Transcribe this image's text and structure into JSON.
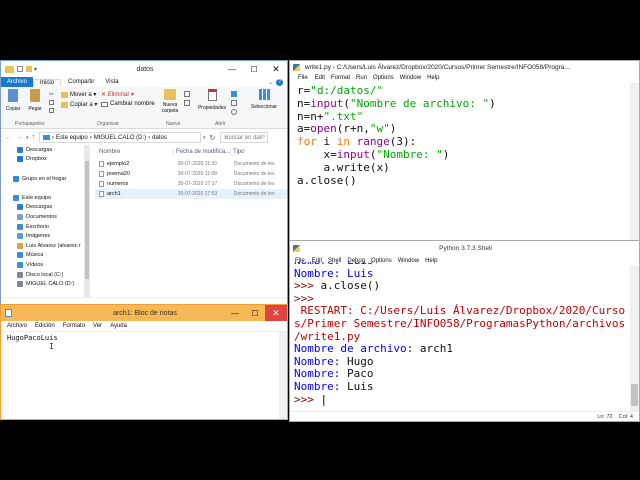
{
  "explorer": {
    "title": "datos",
    "menu_tabs": [
      "Archivo",
      "Inicio",
      "Compartir",
      "Vista"
    ],
    "ribbon": {
      "copiar": "Copiar",
      "pegar": "Pegar",
      "mover_a": "Mover a ▾",
      "copiar_a": "Copiar a ▾",
      "eliminar": "✕ Eliminar ▾",
      "cambiar_nombre": "Cambiar nombre",
      "nueva_carpeta": "Nueva carpeta",
      "propiedades": "Propiedades",
      "seleccionar": "Seleccionar",
      "group_portapapeles": "Portapapeles",
      "group_organizar": "Organizar",
      "group_nuevo": "Nuevo",
      "group_abrir": "Abrir"
    },
    "breadcrumb": [
      "Este equipo",
      "MIGUEL CALO (D:)",
      "datos"
    ],
    "search_placeholder": "Buscar en datos",
    "nav_items": [
      {
        "label": "Descargas",
        "icon": "download-icon",
        "color": "#2f7bd6"
      },
      {
        "label": "Dropbox",
        "icon": "dropbox-icon",
        "color": "#1a73e8"
      },
      {
        "label": "",
        "icon": "",
        "color": ""
      },
      {
        "label": "Grupo en el hogar",
        "icon": "homegroup-icon",
        "color": "#2b8bd6"
      },
      {
        "label": "",
        "icon": "",
        "color": ""
      },
      {
        "label": "Este equipo",
        "icon": "computer-icon",
        "color": "#3a8fd8"
      },
      {
        "label": "Descargas",
        "icon": "download-icon",
        "color": "#2f7bd6"
      },
      {
        "label": "Documentos",
        "icon": "documents-icon",
        "color": "#7f9fc4"
      },
      {
        "label": "Escritorio",
        "icon": "desktop-icon",
        "color": "#3a8fd8"
      },
      {
        "label": "Imágenes",
        "icon": "pictures-icon",
        "color": "#5aa0d8"
      },
      {
        "label": "Luis Álvarez (alvarez-r",
        "icon": "user-icon",
        "color": "#d9a441"
      },
      {
        "label": "Música",
        "icon": "music-icon",
        "color": "#3a8fd8"
      },
      {
        "label": "Vídeos",
        "icon": "videos-icon",
        "color": "#3a8fd8"
      },
      {
        "label": "Disco local (C:)",
        "icon": "drive-icon",
        "color": "#7d8a96"
      },
      {
        "label": "MIGUEL CALO (D:)",
        "icon": "drive-icon",
        "color": "#7d8a96"
      }
    ],
    "columns": [
      "Nombre",
      "Fecha de modifica...",
      "Tipo"
    ],
    "files": [
      {
        "name": "ejemplo2",
        "date": "30-07-2020 11:33",
        "type": "Documento de tex"
      },
      {
        "name": "poema20",
        "date": "30-07-2020 11:08",
        "type": "Documento de tex"
      },
      {
        "name": "numeros",
        "date": "30-07-2020 17:17",
        "type": "Documento de tex"
      },
      {
        "name": "arch1",
        "date": "30-07-2020 17:53",
        "type": "Documento de tex"
      }
    ]
  },
  "notepad": {
    "title": "arch1: Bloc de notas",
    "menu": [
      "Archivo",
      "Edición",
      "Formato",
      "Ver",
      "Ayuda"
    ],
    "content": "HugoPacoLuis"
  },
  "editor": {
    "title": "write1.py - C:/Users/Luis Álvarez/Dropbox/2020/Cursos/Primer Semestre/INFO058/Progra...",
    "menu": [
      "File",
      "Edit",
      "Format",
      "Run",
      "Options",
      "Window",
      "Help"
    ]
  },
  "shell": {
    "title": "Python 3.7.3 Shell",
    "menu": [
      "File",
      "Edit",
      "Shell",
      "Debug",
      "Options",
      "Window",
      "Help"
    ],
    "status": {
      "line": "Ln: 72",
      "col": "Col: 4"
    }
  },
  "colors": {
    "keyword": "#ff7700",
    "builtin": "#900090",
    "string": "#00aa00",
    "output": "#0000ff",
    "restart": "#c00000",
    "prompt": "#8b0000",
    "explorer_tab": "#1979ca"
  }
}
